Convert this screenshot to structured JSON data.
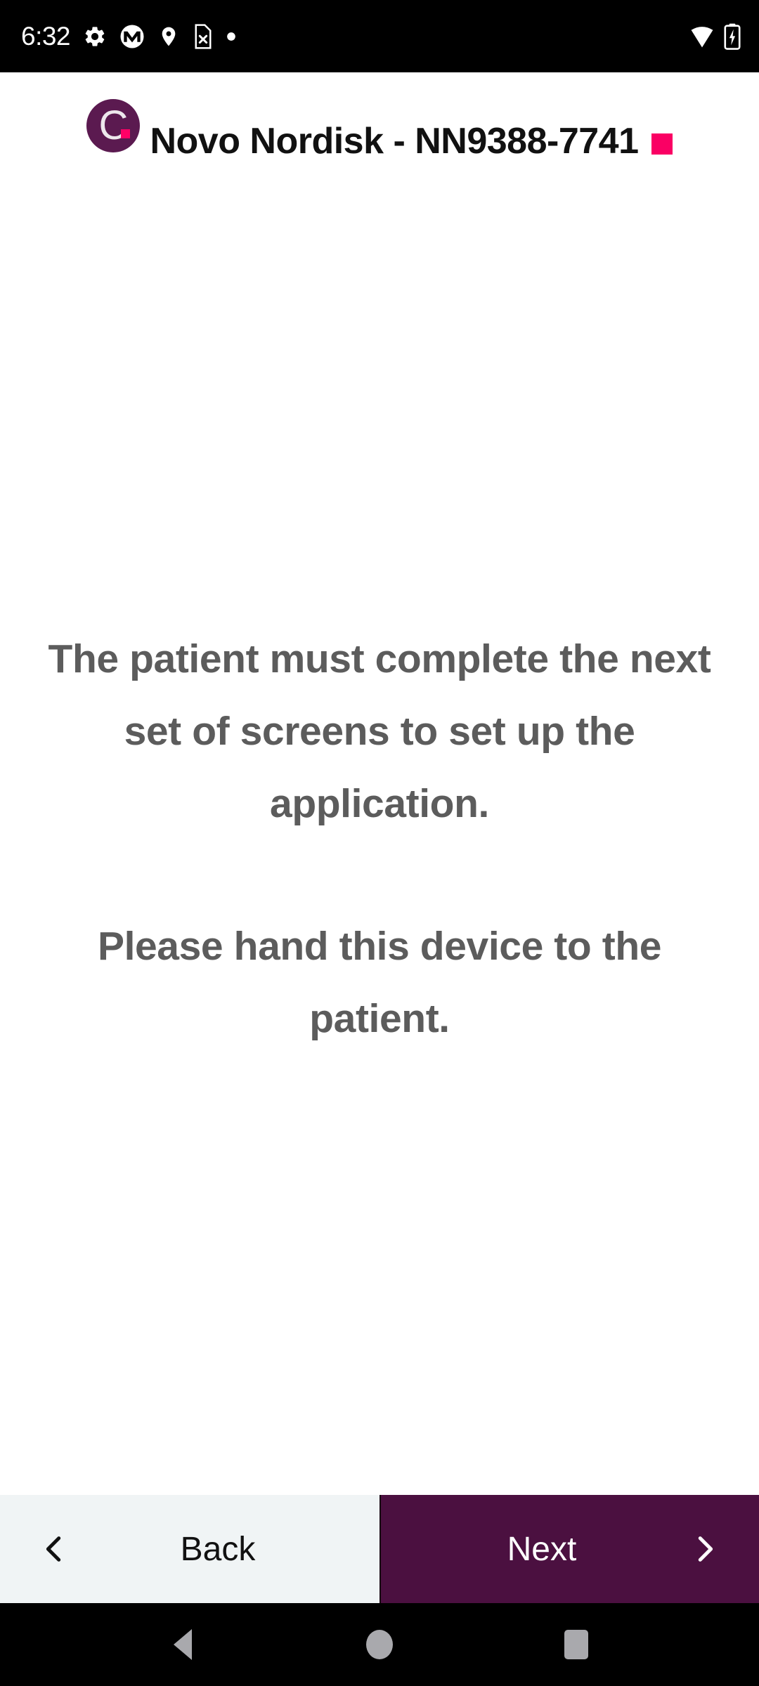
{
  "status_bar": {
    "time": "6:32",
    "left_icons": [
      "gear-icon",
      "motorola-logo-icon",
      "location-pin-icon",
      "sim-card-off-icon",
      "dot-icon"
    ],
    "right_icons": [
      "wifi-icon",
      "battery-charging-icon"
    ],
    "background_color": "#000000",
    "foreground_color": "#FFFFFF"
  },
  "header": {
    "logo_letter": "C",
    "logo_background_color": "#5B1A50",
    "logo_dot_color": "#FF0066",
    "title": "Novo Nordisk - NN9388-7741",
    "accent_square_color": "#FA0064"
  },
  "main": {
    "paragraph_1": "The patient must complete the next set of screens to set up the application.",
    "paragraph_2": "Please hand this device to the patient.",
    "text_color": "#5C5C5C"
  },
  "footer": {
    "back_label": "Back",
    "back_icon": "chevron-left-icon",
    "back_background_color": "#F0F4F5",
    "next_label": "Next",
    "next_icon": "chevron-right-icon",
    "next_background_color": "#4B1040"
  },
  "android_nav": {
    "back_icon": "triangle-back-icon",
    "home_icon": "circle-home-icon",
    "recents_icon": "square-recents-icon",
    "icon_color": "#A9A9AD"
  }
}
